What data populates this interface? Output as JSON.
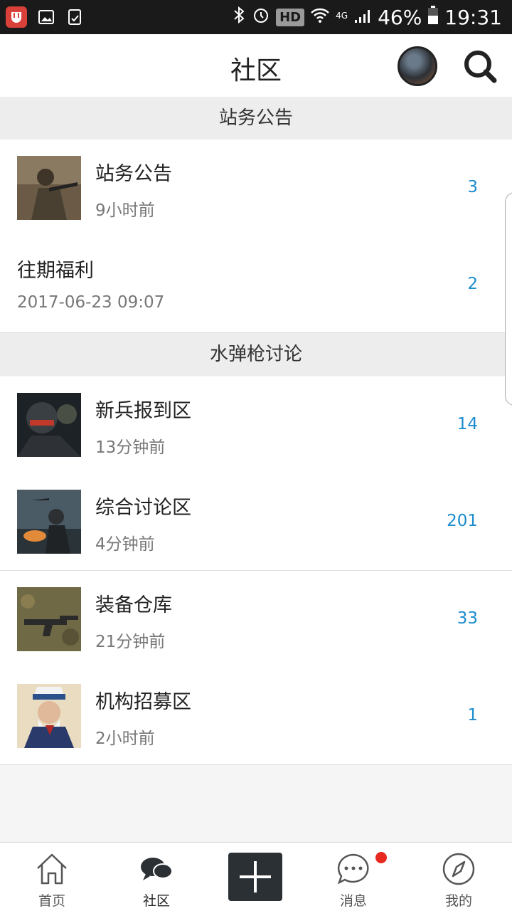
{
  "status_bar": {
    "hd": "HD",
    "net": "4G",
    "battery": "46%",
    "time": "19:31"
  },
  "header": {
    "title": "社区"
  },
  "sections": [
    {
      "title": "站务公告",
      "items": [
        {
          "title": "站务公告",
          "time": "9小时前",
          "count": "3",
          "thumb": "soldier-image"
        },
        {
          "title": "往期福利",
          "time": "2017-06-23 09:07",
          "count": "2"
        }
      ]
    },
    {
      "title": "水弹枪讨论",
      "items": [
        {
          "title": "新兵报到区",
          "time": "13分钟前",
          "count": "14",
          "thumb": "helmet-soldier-image"
        },
        {
          "title": "综合讨论区",
          "time": "4分钟前",
          "count": "201",
          "thumb": "battle-image"
        },
        {
          "title": "装备仓库",
          "time": "21分钟前",
          "count": "33",
          "thumb": "rifle-image"
        },
        {
          "title": "机构招募区",
          "time": "2小时前",
          "count": "1",
          "thumb": "uncle-sam-image"
        }
      ]
    }
  ],
  "bottom_nav": {
    "items": [
      {
        "label": "首页",
        "icon": "home-icon"
      },
      {
        "label": "社区",
        "icon": "community-chat-icon",
        "active": true
      },
      {
        "label": "",
        "icon": "plus-icon"
      },
      {
        "label": "消息",
        "icon": "message-icon",
        "badge": true
      },
      {
        "label": "我的",
        "icon": "compass-icon"
      }
    ]
  },
  "colors": {
    "accent_count": "#1b8ccf",
    "badge": "#e8291f",
    "section_bg": "#ededed"
  }
}
